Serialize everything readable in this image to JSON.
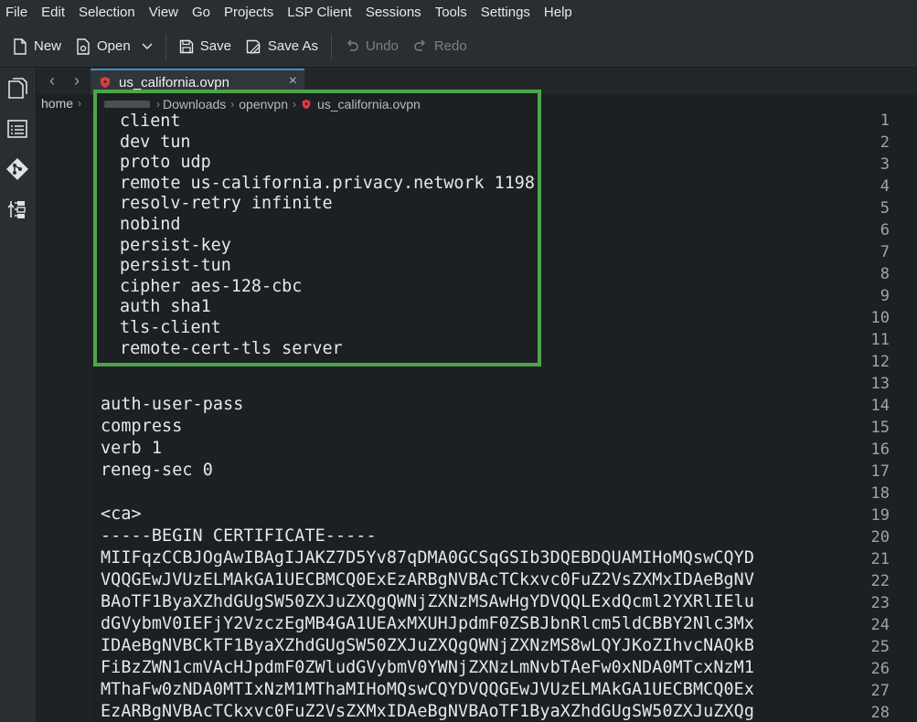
{
  "menubar": {
    "items": [
      "File",
      "Edit",
      "Selection",
      "View",
      "Go",
      "Projects",
      "LSP Client",
      "Sessions",
      "Tools",
      "Settings",
      "Help"
    ]
  },
  "toolbar": {
    "new_label": "New",
    "open_label": "Open",
    "save_label": "Save",
    "save_as_label": "Save As",
    "undo_label": "Undo",
    "redo_label": "Redo"
  },
  "tab": {
    "label": "us_california.ovpn"
  },
  "breadcrumb": {
    "home": "home",
    "downloads": "Downloads",
    "openvpn": "openvpn",
    "file": "us_california.ovpn"
  },
  "editor": {
    "line_numbers": [
      "1",
      "2",
      "3",
      "4",
      "5",
      "6",
      "7",
      "8",
      "9",
      "10",
      "11",
      "12",
      "13",
      "14",
      "15",
      "16",
      "17",
      "18",
      "19",
      "20",
      "21",
      "22",
      "23",
      "24",
      "25",
      "26",
      "27",
      "28"
    ],
    "boxed_lines": [
      "client",
      "dev tun",
      "proto udp",
      "remote us-california.privacy.network 1198",
      "resolv-retry infinite",
      "nobind",
      "persist-key",
      "persist-tun",
      "cipher aes-128-cbc",
      "auth sha1",
      "tls-client",
      "remote-cert-tls server"
    ],
    "lines": [
      "",
      "auth-user-pass",
      "compress",
      "verb 1",
      "reneg-sec 0",
      "",
      "<ca>",
      "-----BEGIN CERTIFICATE-----",
      "MIIFqzCCBJOgAwIBAgIJAKZ7D5Yv87qDMA0GCSqGSIb3DQEBDQUAMIHoMQswCQYD",
      "VQQGEwJVUzELMAkGA1UECBMCQ0ExEzARBgNVBAcTCkxvc0FuZ2VsZXMxIDAeBgNV",
      "BAoTF1ByaXZhdGUgSW50ZXJuZXQgQWNjZXNzMSAwHgYDVQQLExdQcml2YXRlIElu",
      "dGVybmV0IEFjY2VzczEgMB4GA1UEAxMXUHJpdmF0ZSBJbnRlcm5ldCBBY2Nlc3Mx",
      "IDAeBgNVBCkTF1ByaXZhdGUgSW50ZXJuZXQgQWNjZXNzMS8wLQYJKoZIhvcNAQkB",
      "FiBzZWN1cmVAcHJpdmF0ZWludGVybmV0YWNjZXNzLmNvbTAeFw0xNDA0MTcxNzM1",
      "MThaFw0zNDA0MTIxNzM1MThaMIHoMQswCQYDVQQGEwJVUzELMAkGA1UECBMCQ0Ex",
      "EzARBgNVBAcTCkxvc0FuZ2VsZXMxIDAeBgNVBAoTF1ByaXZhdGUgSW50ZXJuZXQg"
    ]
  }
}
